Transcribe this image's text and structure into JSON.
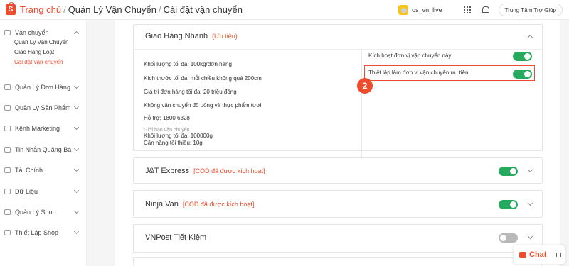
{
  "header": {
    "breadcrumb": [
      "Trang chủ",
      "Quản Lý Vận Chuyển",
      "Cài đặt vận chuyển"
    ],
    "username": "os_vn_live",
    "help_label": "Trung Tâm Trợ Giúp"
  },
  "sidebar": {
    "groups": [
      {
        "label": "Vận chuyển",
        "icon": "truck-icon",
        "expanded": true,
        "items": [
          "Quản Lý Vận Chuyển",
          "Giao Hàng Loạt",
          "Cài đặt vận chuyển"
        ]
      },
      {
        "label": "Quản Lý Đơn Hàng",
        "icon": "order-icon"
      },
      {
        "label": "Quản Lý Sản Phẩm",
        "icon": "product-icon"
      },
      {
        "label": "Kênh Marketing",
        "icon": "tag-icon"
      },
      {
        "label": "Tin Nhắn Quảng Bá",
        "icon": "message-icon"
      },
      {
        "label": "Tài Chính",
        "icon": "wallet-icon"
      },
      {
        "label": "Dữ Liệu",
        "icon": "chart-icon"
      },
      {
        "label": "Quản Lý Shop",
        "icon": "shop-icon"
      },
      {
        "label": "Thiết Lập Shop",
        "icon": "gear-icon"
      }
    ]
  },
  "carriers": [
    {
      "name": "Giao Hàng Nhanh",
      "tag": "(Ưu tiên)",
      "info": [
        "Khối lượng tối đa: 100kg/đơn hàng",
        "Kích thước tối đa: mỗi chiều không quá 200cm",
        "Giá trị đơn hàng tối đa: 20 triệu đồng",
        "Không vận chuyển đồ uống và thực phẩm tươi",
        "Hỗ trợ: 1800 6328"
      ],
      "limit_title": "Giới hạn vận chuyển",
      "limits": [
        "Khối lượng tối đa: 100000g",
        "Cân nặng tối thiểu: 10g"
      ],
      "options": [
        {
          "label": "Kích hoạt đơn vị vận chuyển này",
          "on": true
        },
        {
          "label": "Thiết lập làm đơn vị vận chuyển ưu tiên",
          "on": true
        }
      ]
    },
    {
      "name": "J&T Express",
      "tag": "[COD đã được kích hoạt]",
      "on": true
    },
    {
      "name": "Ninja Van",
      "tag": "[COD đã được kích hoạt]",
      "on": true
    },
    {
      "name": "VNPost Tiết Kiệm",
      "tag": "",
      "on": false
    }
  ],
  "step_badge": "2",
  "chat": {
    "label": "Chat"
  },
  "colors": {
    "accent": "#ee4d2d",
    "toggle_on": "#26aa5f",
    "toggle_off": "#b8b8b8"
  }
}
